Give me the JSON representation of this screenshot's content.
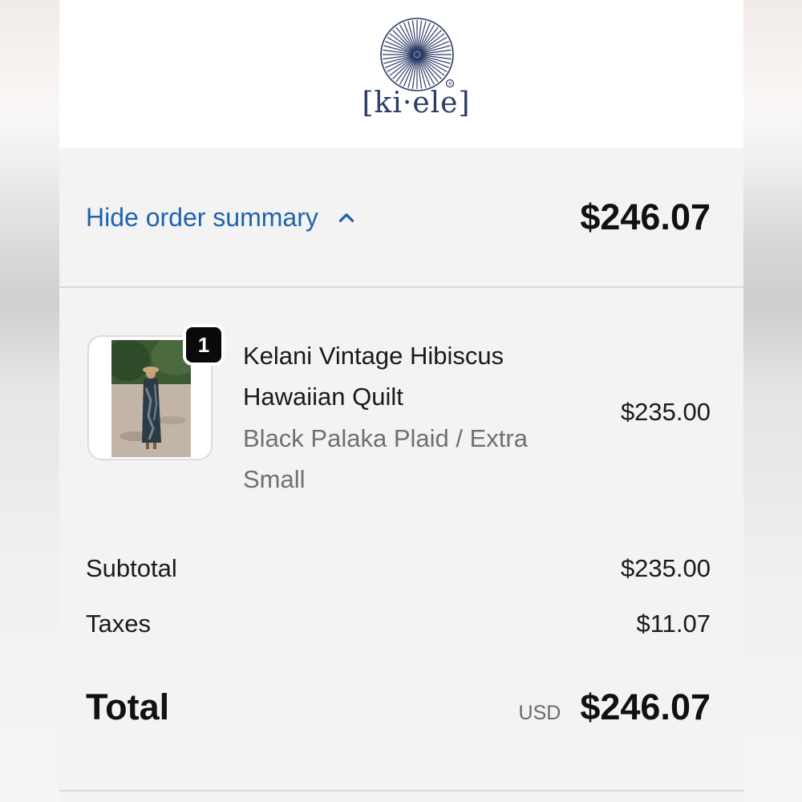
{
  "brand": {
    "logo_text": "[ki·ele]"
  },
  "summary": {
    "toggle_label": "Hide order summary",
    "toggle_icon": "chevron-up-icon",
    "header_total": "$246.07"
  },
  "line_item": {
    "quantity": "1",
    "name": "Kelani Vintage Hibiscus Hawaiian Quilt",
    "variant": "Black Palaka Plaid / Extra Small",
    "price": "$235.00"
  },
  "totals": {
    "subtotal_label": "Subtotal",
    "subtotal_value": "$235.00",
    "taxes_label": "Taxes",
    "taxes_value": "$11.07",
    "total_label": "Total",
    "currency": "USD",
    "total_value": "$246.07"
  },
  "colors": {
    "link": "#1f63ad",
    "brand_navy": "#2c3c66",
    "badge": "#0a0a0a"
  }
}
